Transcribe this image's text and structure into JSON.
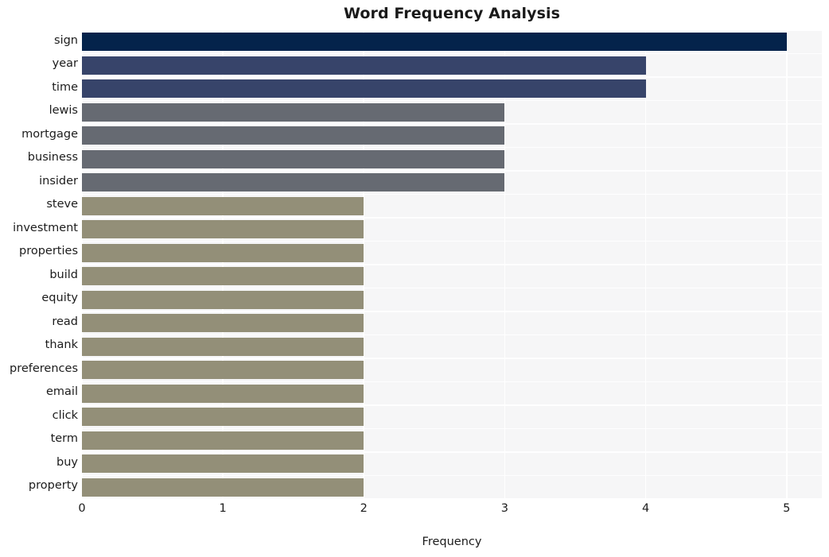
{
  "chart_data": {
    "type": "bar",
    "orientation": "horizontal",
    "title": "Word Frequency Analysis",
    "xlabel": "Frequency",
    "ylabel": "",
    "categories": [
      "sign",
      "year",
      "time",
      "lewis",
      "mortgage",
      "business",
      "insider",
      "steve",
      "investment",
      "properties",
      "build",
      "equity",
      "read",
      "thank",
      "preferences",
      "email",
      "click",
      "term",
      "buy",
      "property"
    ],
    "values": [
      5,
      4,
      4,
      3,
      3,
      3,
      3,
      2,
      2,
      2,
      2,
      2,
      2,
      2,
      2,
      2,
      2,
      2,
      2,
      2
    ],
    "bar_colors": [
      "#04234b",
      "#37446a",
      "#37446a",
      "#666a72",
      "#666a72",
      "#666a72",
      "#666a72",
      "#938f78",
      "#938f78",
      "#938f78",
      "#938f78",
      "#938f78",
      "#938f78",
      "#938f78",
      "#938f78",
      "#938f78",
      "#938f78",
      "#938f78",
      "#938f78",
      "#938f78"
    ],
    "xlim": [
      0,
      5.25
    ],
    "xticks": [
      0,
      1,
      2,
      3,
      4,
      5
    ],
    "xtick_labels": [
      "0",
      "1",
      "2",
      "3",
      "4",
      "5"
    ],
    "grid": true,
    "grid_color": "#ffffff",
    "plot_background": "#f6f6f7",
    "figure_background": "#ffffff",
    "legend": null,
    "style": "seaborn-whitegrid"
  }
}
